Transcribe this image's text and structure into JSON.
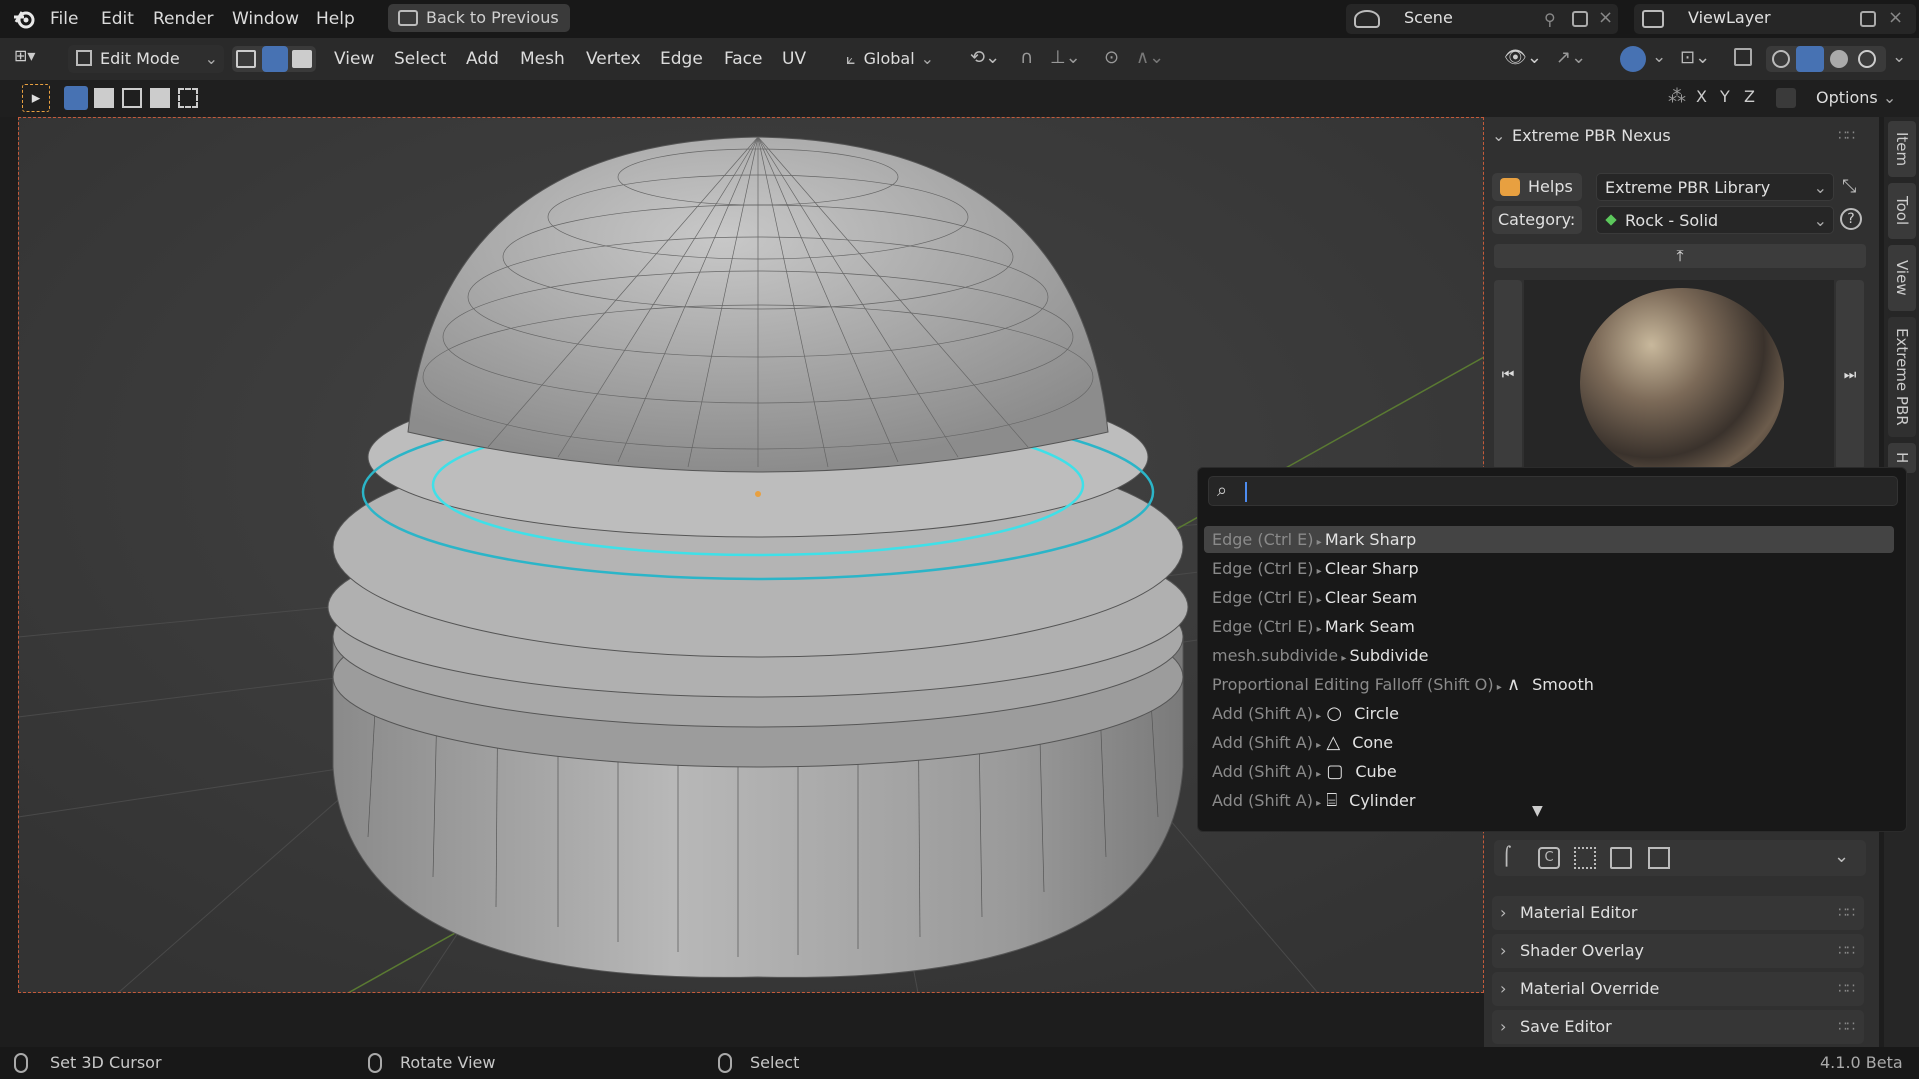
{
  "topbar": {
    "menus": [
      "File",
      "Edit",
      "Render",
      "Window",
      "Help"
    ],
    "back_button": "Back to Previous",
    "scene_label": "Scene",
    "viewlayer_label": "ViewLayer"
  },
  "header": {
    "mode": "Edit Mode",
    "menus": [
      "View",
      "Select",
      "Add",
      "Mesh",
      "Vertex",
      "Edge",
      "Face",
      "UV"
    ],
    "orientation": "Global",
    "axes": [
      "X",
      "Y",
      "Z"
    ],
    "options": "Options"
  },
  "sidebar": {
    "panel_title": "Extreme PBR Nexus",
    "helps_button": "Helps",
    "library_dropdown": "Extreme PBR Library",
    "category_label": "Category:",
    "category_value": "Rock - Solid",
    "sections": [
      "Material Editor",
      "Shader Overlay",
      "Material Override",
      "Save Editor"
    ],
    "tabs": [
      "Item",
      "Tool",
      "View",
      "Extreme PBR",
      "H"
    ]
  },
  "search_popup": {
    "query": "",
    "items": [
      {
        "prefix": "Edge (Ctrl E)",
        "label": "Mark Sharp",
        "icon": "",
        "selected": true
      },
      {
        "prefix": "Edge (Ctrl E)",
        "label": "Clear Sharp",
        "icon": "",
        "selected": false
      },
      {
        "prefix": "Edge (Ctrl E)",
        "label": "Clear Seam",
        "icon": "",
        "selected": false
      },
      {
        "prefix": "Edge (Ctrl E)",
        "label": "Mark Seam",
        "icon": "",
        "selected": false
      },
      {
        "prefix": "mesh.subdivide",
        "label": "Subdivide",
        "icon": "",
        "selected": false
      },
      {
        "prefix": "Proportional Editing Falloff (Shift O)",
        "label": "Smooth",
        "icon": "smooth-falloff-icon",
        "selected": false
      },
      {
        "prefix": "Add (Shift A)",
        "label": "Circle",
        "icon": "circle-icon",
        "selected": false
      },
      {
        "prefix": "Add (Shift A)",
        "label": "Cone",
        "icon": "cone-icon",
        "selected": false
      },
      {
        "prefix": "Add (Shift A)",
        "label": "Cube",
        "icon": "cube-icon",
        "selected": false
      },
      {
        "prefix": "Add (Shift A)",
        "label": "Cylinder",
        "icon": "cylinder-icon",
        "selected": false
      }
    ]
  },
  "statusbar": {
    "left": "Set 3D Cursor",
    "middle": "Rotate View",
    "right": "Select",
    "version": "4.1.0 Beta"
  },
  "colors": {
    "selection_edge": "#3fe0e8",
    "accent_blue": "#4772b3"
  }
}
